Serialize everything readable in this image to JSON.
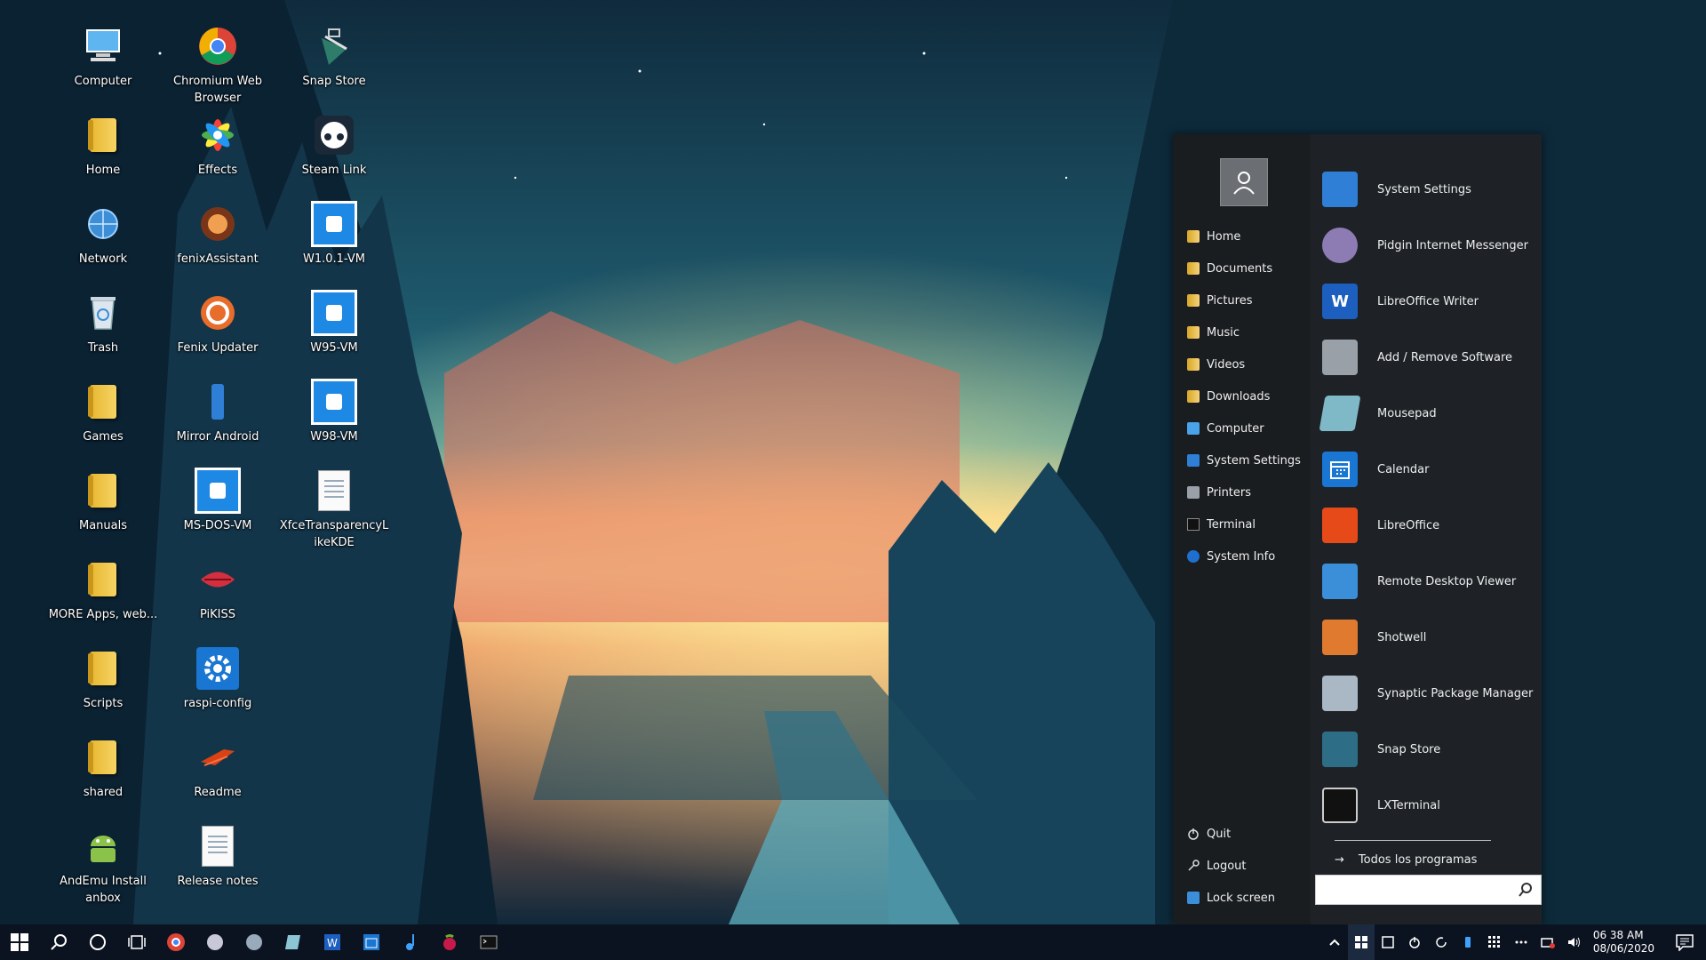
{
  "desktop": {
    "icons": [
      {
        "label": "Computer",
        "icon": "computer-icon"
      },
      {
        "label": "Home",
        "icon": "home-folder-icon"
      },
      {
        "label": "Network",
        "icon": "network-icon"
      },
      {
        "label": "Trash",
        "icon": "trash-icon"
      },
      {
        "label": "Games",
        "icon": "folder-icon"
      },
      {
        "label": "Manuals",
        "icon": "folder-icon"
      },
      {
        "label": "MORE Apps, web...",
        "icon": "folder-icon"
      },
      {
        "label": "Scripts",
        "icon": "folder-icon"
      },
      {
        "label": "shared",
        "icon": "folder-link-icon"
      },
      {
        "label": "AndEmu Install anbox",
        "icon": "android-icon"
      },
      {
        "label": "Chromium Web Browser",
        "icon": "chromium-icon"
      },
      {
        "label": "Effects",
        "icon": "effects-icon"
      },
      {
        "label": "fenixAssistant",
        "icon": "fenix-assistant-icon"
      },
      {
        "label": "Fenix Updater",
        "icon": "fenix-updater-icon"
      },
      {
        "label": "Mirror Android",
        "icon": "mirror-android-icon"
      },
      {
        "label": "MS-DOS-VM",
        "icon": "vm-icon"
      },
      {
        "label": "PiKISS",
        "icon": "pikiss-icon"
      },
      {
        "label": "raspi-config",
        "icon": "gear-icon"
      },
      {
        "label": "Readme",
        "icon": "readme-icon"
      },
      {
        "label": "Release notes",
        "icon": "document-icon"
      },
      {
        "label": "Snap Store",
        "icon": "snap-store-icon"
      },
      {
        "label": "Steam Link",
        "icon": "steam-link-icon"
      },
      {
        "label": "W1.0.1-VM",
        "icon": "vm-icon"
      },
      {
        "label": "W95-VM",
        "icon": "vm-icon"
      },
      {
        "label": "W98-VM",
        "icon": "vm-icon"
      },
      {
        "label": "XfceTransparencyLikeKDE",
        "icon": "document-icon"
      }
    ]
  },
  "start_menu": {
    "user_avatar": "user-icon",
    "places": [
      {
        "label": "Home",
        "icon": "folder-icon"
      },
      {
        "label": "Documents",
        "icon": "folder-icon"
      },
      {
        "label": "Pictures",
        "icon": "folder-icon"
      },
      {
        "label": "Music",
        "icon": "folder-icon"
      },
      {
        "label": "Videos",
        "icon": "folder-icon"
      },
      {
        "label": "Downloads",
        "icon": "folder-icon"
      },
      {
        "label": "Computer",
        "icon": "computer-icon"
      },
      {
        "label": "System Settings",
        "icon": "settings-icon"
      },
      {
        "label": "Printers",
        "icon": "printer-icon"
      },
      {
        "label": "Terminal",
        "icon": "terminal-icon"
      },
      {
        "label": "System Info",
        "icon": "info-icon"
      }
    ],
    "session": [
      {
        "label": "Quit",
        "icon": "power-icon"
      },
      {
        "label": "Logout",
        "icon": "key-icon"
      },
      {
        "label": "Lock screen",
        "icon": "lock-screen-icon"
      }
    ],
    "apps": [
      {
        "label": "System Settings",
        "icon": "system-settings-icon",
        "color": "#2f7fd6"
      },
      {
        "label": "Pidgin Internet Messenger",
        "icon": "pidgin-icon",
        "color": "#8d7bb3"
      },
      {
        "label": "LibreOffice Writer",
        "icon": "writer-icon",
        "color": "#1c5fbf"
      },
      {
        "label": "Add / Remove Software",
        "icon": "software-icon",
        "color": "#9aa0a8"
      },
      {
        "label": "Mousepad",
        "icon": "mousepad-icon",
        "color": "#7fb9c8"
      },
      {
        "label": "Calendar",
        "icon": "calendar-icon",
        "color": "#1976d2"
      },
      {
        "label": "LibreOffice",
        "icon": "office-icon",
        "color": "#e64a19"
      },
      {
        "label": "Remote Desktop Viewer",
        "icon": "remote-desktop-icon",
        "color": "#3a8fd8"
      },
      {
        "label": "Shotwell",
        "icon": "shotwell-icon",
        "color": "#e07a2e"
      },
      {
        "label": "Synaptic Package Manager",
        "icon": "synaptic-icon",
        "color": "#a9b8c4"
      },
      {
        "label": "Snap Store",
        "icon": "snap-store-icon",
        "color": "#2e6d86"
      },
      {
        "label": "LXTerminal",
        "icon": "lxterminal-icon",
        "color": "#222222"
      }
    ],
    "all_programs": "Todos los programas",
    "search": {
      "value": "",
      "placeholder": ""
    }
  },
  "taskbar": {
    "buttons": [
      "windows-start-icon",
      "search-icon",
      "cortana-circle-icon",
      "task-view-icon",
      "chromium-icon",
      "pidgin-icon",
      "synaptic-icon",
      "mousepad-icon",
      "writer-icon",
      "calendar-icon",
      "music-icon",
      "raspberry-icon",
      "terminal-icon"
    ],
    "tray": [
      "chevron-up-icon",
      "windows-logo-icon",
      "note-icon",
      "power-icon",
      "refresh-icon",
      "phone-icon",
      "grid-icon",
      "ellipsis-icon",
      "network-tray-icon",
      "volume-icon"
    ],
    "clock_time": "06 38 AM",
    "clock_date": "08/06/2020",
    "notifications_icon": "notification-center-icon"
  }
}
